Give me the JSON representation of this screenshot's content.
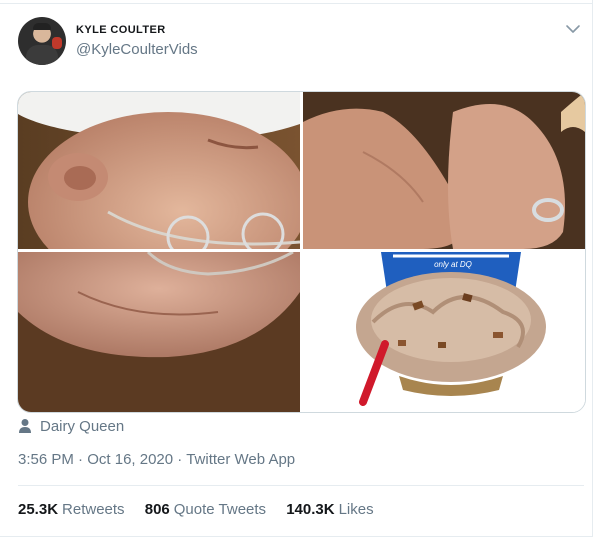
{
  "tweet": {
    "author": {
      "display_name": "KYLE COULTER",
      "handle": "@KyleCoulterVids",
      "avatar_icon": "avatar-photo"
    },
    "menu_icon": "chevron-down-icon",
    "media": [
      {
        "position": "top-left",
        "description_icon": "photo"
      },
      {
        "position": "top-right",
        "description_icon": "photo"
      },
      {
        "position": "bottom-left",
        "description_icon": "photo"
      },
      {
        "position": "bottom-right",
        "description_icon": "photo",
        "cup_text": "only at DQ"
      }
    ],
    "location": {
      "icon": "location-pin-icon",
      "label": "Dairy Queen"
    },
    "time": "3:56 PM",
    "separator": "·",
    "date": "Oct 16, 2020",
    "source": "Twitter Web App",
    "stats": {
      "retweets_count": "25.3K",
      "retweets_label": "Retweets",
      "quotes_count": "806",
      "quotes_label": "Quote Tweets",
      "likes_count": "140.3K",
      "likes_label": "Likes"
    },
    "colors": {
      "secondary_text": "#657786",
      "primary_text": "#14171a",
      "border": "#e6ecf0",
      "dq_red": "#d0192b",
      "dq_blue": "#1f5fbf"
    }
  }
}
